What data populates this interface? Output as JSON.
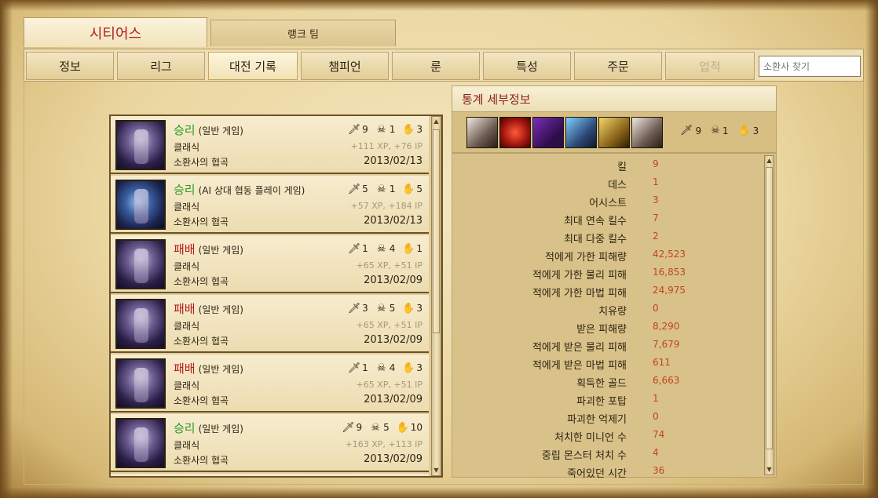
{
  "tabs": {
    "summoner_name": "시티어스",
    "ranked_team": "랭크 팀"
  },
  "nav": [
    {
      "label": "정보"
    },
    {
      "label": "리그"
    },
    {
      "label": "대전 기록",
      "active": true
    },
    {
      "label": "챔피언"
    },
    {
      "label": "룬"
    },
    {
      "label": "특성"
    },
    {
      "label": "주문"
    },
    {
      "label": "업적",
      "disabled": true
    }
  ],
  "search": {
    "placeholder": "소환사 찾기"
  },
  "matches": [
    {
      "result": "승리",
      "outcome": "win",
      "game_type": "(일반 게임)",
      "mode": "클래식",
      "map": "소환사의 협곡",
      "kills": "9",
      "deaths": "1",
      "assists": "3",
      "rewards": "+111 XP, +76 IP",
      "date": "2013/02/13"
    },
    {
      "result": "승리",
      "outcome": "win",
      "game_type": "(AI 상대 협동 플레이 게임)",
      "mode": "클래식",
      "map": "소환사의 협곡",
      "kills": "5",
      "deaths": "1",
      "assists": "5",
      "rewards": "+57 XP, +184 IP",
      "date": "2013/02/13"
    },
    {
      "result": "패배",
      "outcome": "loss",
      "game_type": "(일반 게임)",
      "mode": "클래식",
      "map": "소환사의 협곡",
      "kills": "1",
      "deaths": "4",
      "assists": "1",
      "rewards": "+65 XP, +51 IP",
      "date": "2013/02/09"
    },
    {
      "result": "패배",
      "outcome": "loss",
      "game_type": "(일반 게임)",
      "mode": "클래식",
      "map": "소환사의 협곡",
      "kills": "3",
      "deaths": "5",
      "assists": "3",
      "rewards": "+65 XP, +51 IP",
      "date": "2013/02/09"
    },
    {
      "result": "패배",
      "outcome": "loss",
      "game_type": "(일반 게임)",
      "mode": "클래식",
      "map": "소환사의 협곡",
      "kills": "1",
      "deaths": "4",
      "assists": "3",
      "rewards": "+65 XP, +51 IP",
      "date": "2013/02/09"
    },
    {
      "result": "승리",
      "outcome": "win",
      "game_type": "(일반 게임)",
      "mode": "클래식",
      "map": "소환사의 협곡",
      "kills": "9",
      "deaths": "5",
      "assists": "10",
      "rewards": "+163 XP, +113 IP",
      "date": "2013/02/09"
    }
  ],
  "stats_panel": {
    "title": "통계 세부정보",
    "kills": "9",
    "deaths": "1",
    "assists": "3",
    "stats": [
      {
        "label": "킬",
        "value": "9"
      },
      {
        "label": "데스",
        "value": "1"
      },
      {
        "label": "어시스트",
        "value": "3"
      },
      {
        "label": "최대 연속 킬수",
        "value": "7"
      },
      {
        "label": "최대 다중 킬수",
        "value": "2"
      },
      {
        "label": "적에게 가한 피해량",
        "value": "42,523"
      },
      {
        "label": "적에게 가한 물리 피해",
        "value": "16,853"
      },
      {
        "label": "적에게 가한 마법 피해",
        "value": "24,975"
      },
      {
        "label": "치유량",
        "value": "0"
      },
      {
        "label": "받은 피해량",
        "value": "8,290"
      },
      {
        "label": "적에게 받은 물리 피해",
        "value": "7,679"
      },
      {
        "label": "적에게 받은 마법 피해",
        "value": "611"
      },
      {
        "label": "획득한 골드",
        "value": "6,663"
      },
      {
        "label": "파괴한 포탑",
        "value": "1"
      },
      {
        "label": "파괴한 억제기",
        "value": "0"
      },
      {
        "label": "처치한 미니언 수",
        "value": "74"
      },
      {
        "label": "중립 몬스터 처치 수",
        "value": "4"
      },
      {
        "label": "죽어있던 시간",
        "value": "36"
      }
    ]
  },
  "icons": {
    "kills": "sword-icon",
    "deaths": "skull-icon",
    "assists": "hand-icon"
  },
  "colors": {
    "win": "#2a9a22",
    "loss": "#b21d1d",
    "title": "#8b1f1f",
    "stat_value": "#c0431f"
  }
}
